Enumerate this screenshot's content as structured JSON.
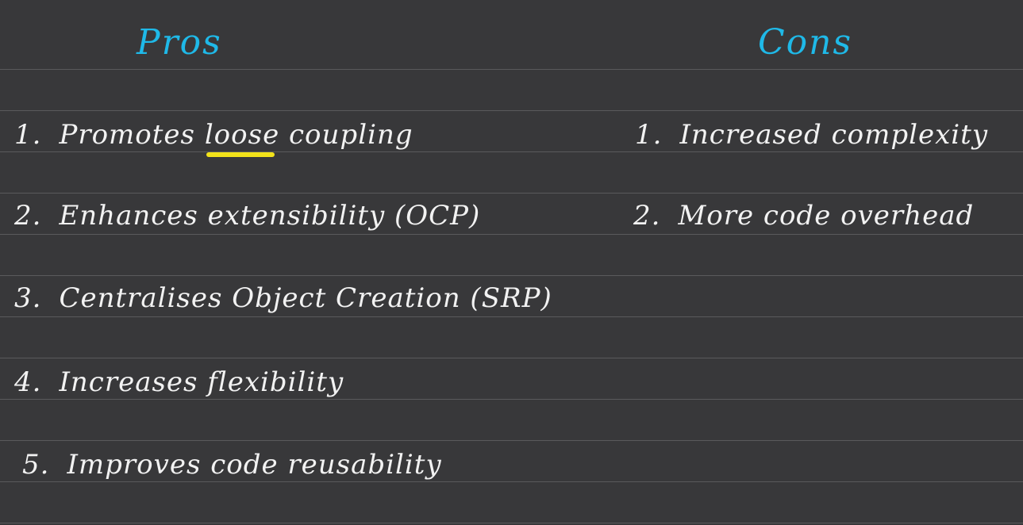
{
  "pros": {
    "heading": "Pros",
    "items": [
      {
        "num": "1.",
        "before": "Promotes",
        "highlight": "loose",
        "after": "coupling"
      },
      {
        "num": "2.",
        "text": "Enhances extensibility (OCP)"
      },
      {
        "num": "3.",
        "text": "Centralises Object Creation (SRP)"
      },
      {
        "num": "4.",
        "text": "Increases flexibility"
      },
      {
        "num": "5.",
        "text": "Improves code reusability"
      }
    ]
  },
  "cons": {
    "heading": "Cons",
    "items": [
      {
        "num": "1.",
        "text": "Increased complexity"
      },
      {
        "num": "2.",
        "text": "More code overhead"
      }
    ]
  },
  "colors": {
    "background": "#38383a",
    "heading": "#1fb9e8",
    "ink": "#f2f2f2",
    "highlighter": "#f2e21a"
  }
}
